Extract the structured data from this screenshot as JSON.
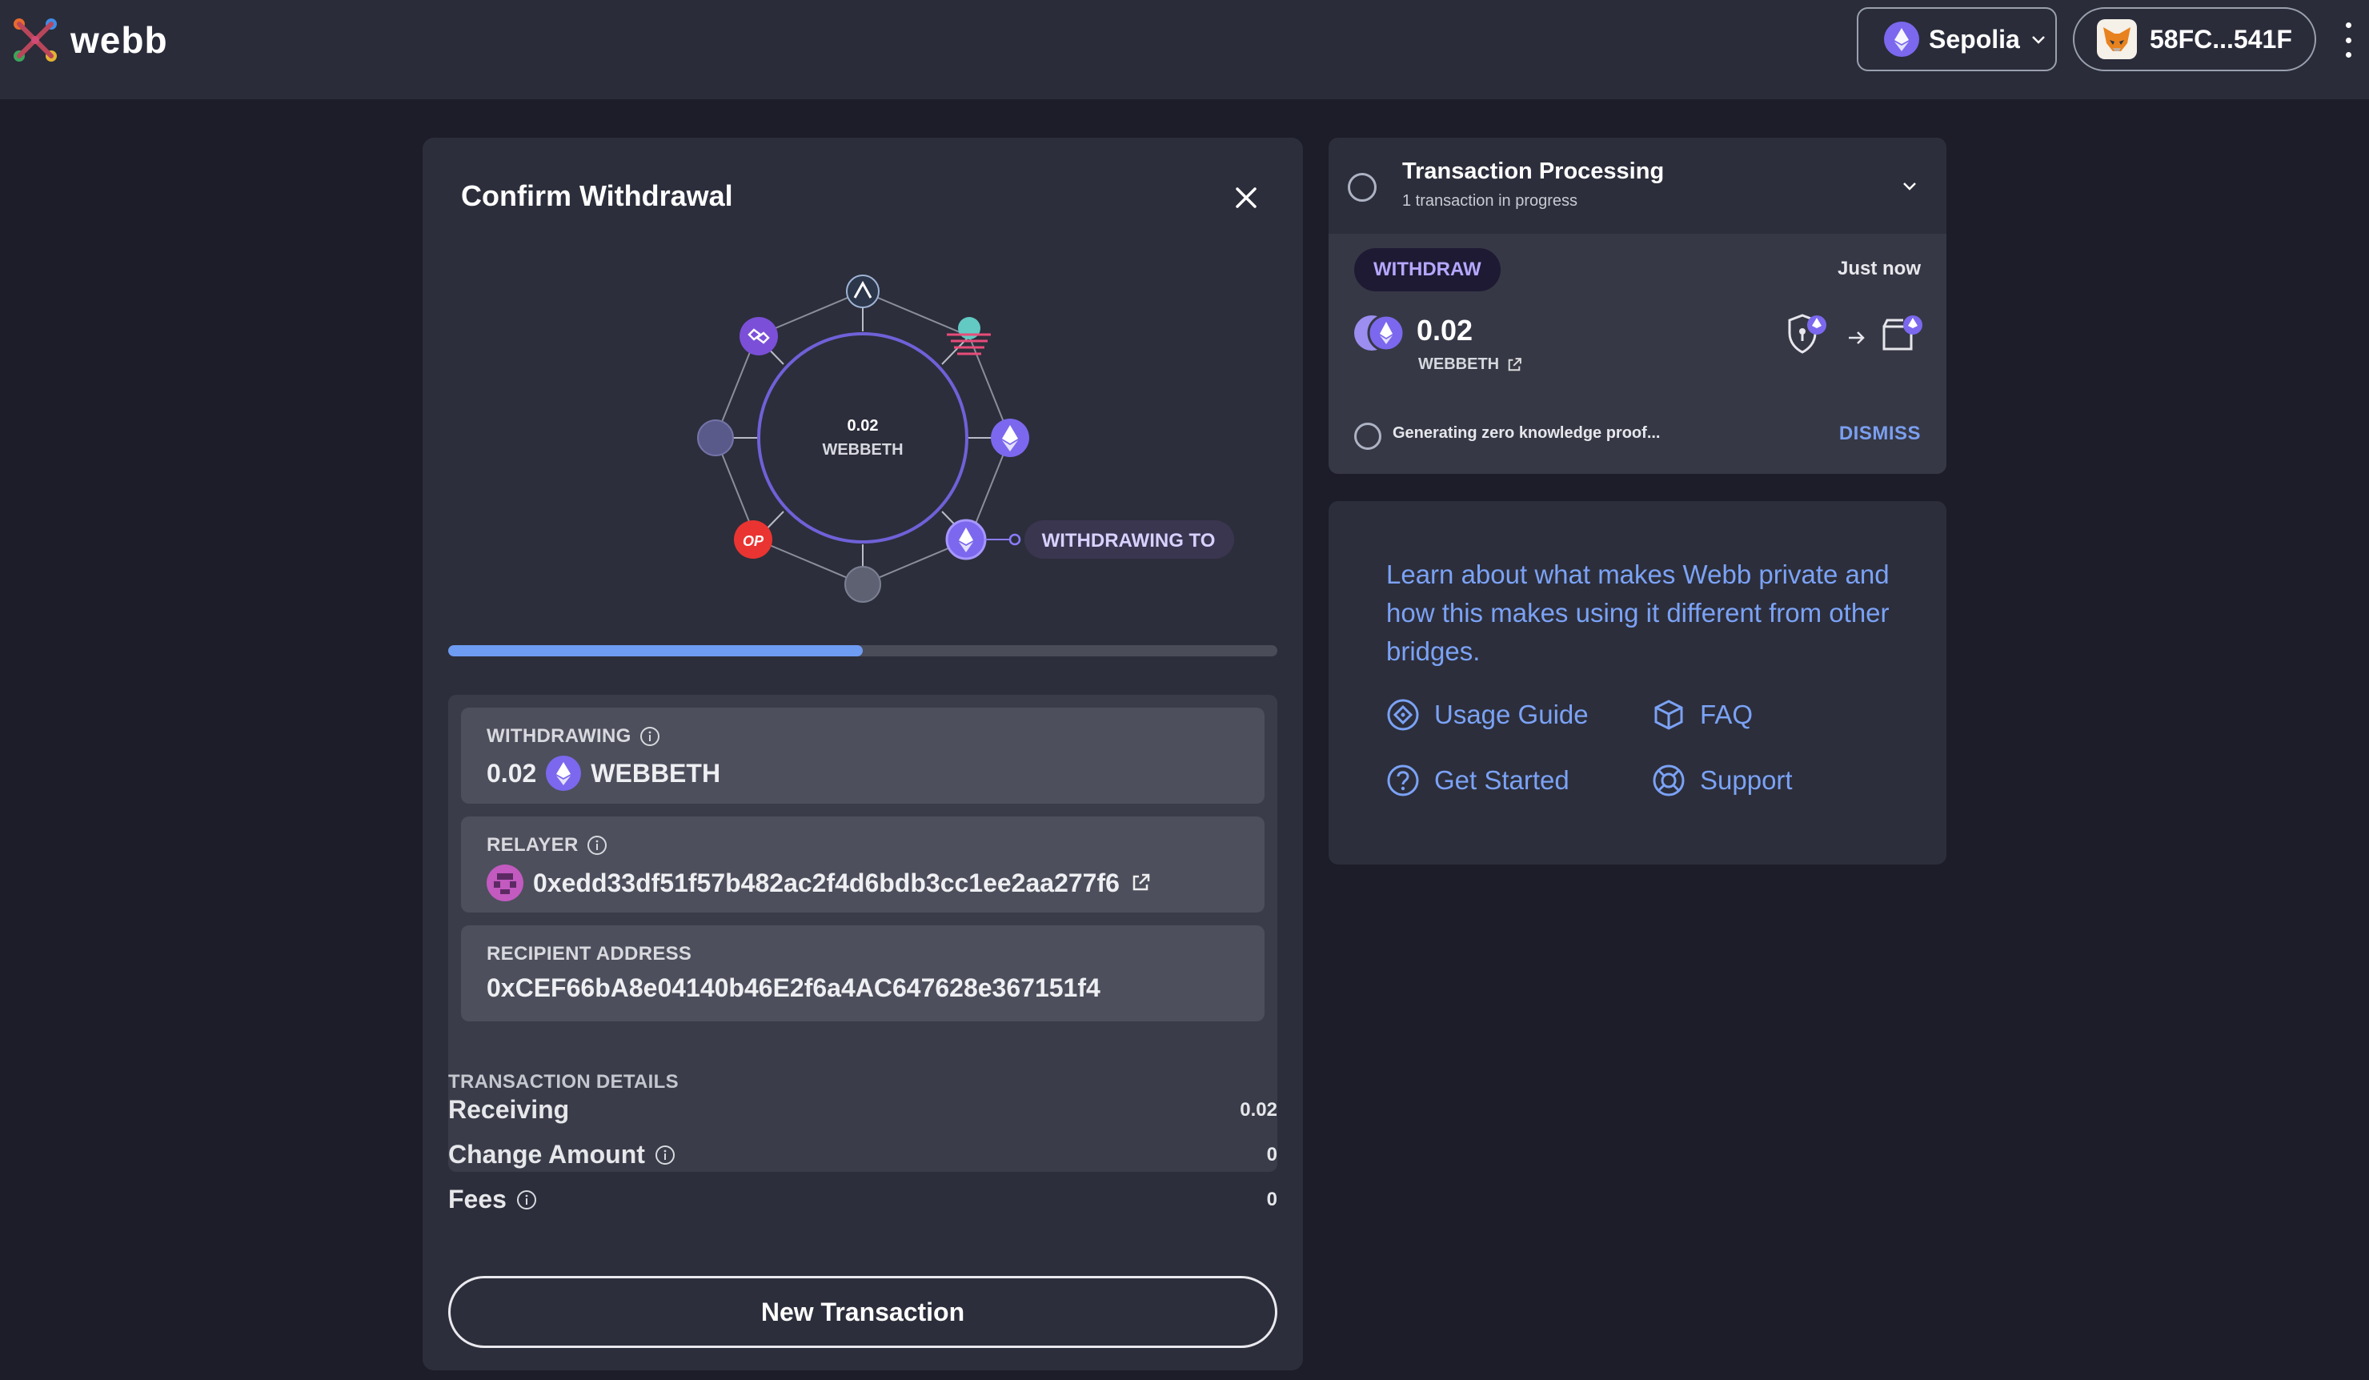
{
  "header": {
    "brand": "webb",
    "network": "Sepolia",
    "account": "58FC...541F"
  },
  "withdraw_card": {
    "title": "Confirm Withdrawal",
    "diagram": {
      "center_amount": "0.02",
      "center_token": "WEBBETH",
      "destination_label": "WITHDRAWING TO",
      "op_badge": "OP"
    },
    "progress_fraction": 0.5,
    "withdrawing": {
      "label": "WITHDRAWING",
      "amount": "0.02",
      "token": "WEBBETH"
    },
    "relayer": {
      "label": "RELAYER",
      "address": "0xedd33df51f57b482ac2f4d6bdb3cc1ee2aa277f6"
    },
    "recipient": {
      "label": "RECIPIENT ADDRESS",
      "address": "0xCEF66bA8e04140b46E2f6a4AC647628e367151f4"
    },
    "details": {
      "title": "TRANSACTION DETAILS",
      "rows": [
        {
          "label": "Receiving",
          "value": "0.02"
        },
        {
          "label": "Change Amount",
          "value": "0"
        },
        {
          "label": "Fees",
          "value": "0"
        }
      ]
    },
    "new_tx_label": "New Transaction"
  },
  "tx_panel": {
    "title": "Transaction Processing",
    "subtitle": "1 transaction in progress",
    "type": "WITHDRAW",
    "time": "Just now",
    "amount": "0.02",
    "token": "WEBBETH",
    "status": "Generating zero knowledge proof...",
    "dismiss": "DISMISS"
  },
  "learn": {
    "text": "Learn about what makes Webb private and how this makes using it different from other bridges.",
    "links": [
      "Usage Guide",
      "FAQ",
      "Get Started",
      "Support"
    ]
  },
  "colors": {
    "background": "#1d1d29",
    "panel": "#2c2e3b",
    "accent_blue": "#7ba2f5",
    "eth_purple": "#7b68ee",
    "progress": "#6e9cf3"
  }
}
